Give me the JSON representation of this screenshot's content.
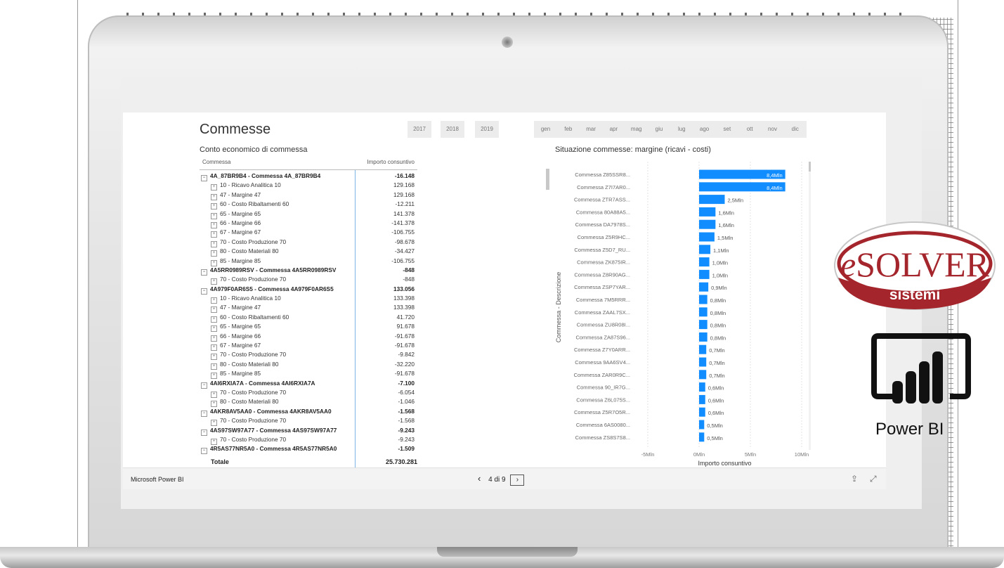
{
  "report": {
    "title": "Commesse",
    "years": [
      "2017",
      "2018",
      "2019"
    ],
    "months": [
      "gen",
      "feb",
      "mar",
      "apr",
      "mag",
      "giu",
      "lug",
      "ago",
      "set",
      "ott",
      "nov",
      "dic"
    ]
  },
  "table": {
    "title": "Conto economico di commessa",
    "col_commessa": "Commessa",
    "col_importo": "Importo consuntivo",
    "rows": [
      {
        "label": "4A_87BR9B4 - Commessa 4A_87BR9B4",
        "value": "-16.148",
        "bold": true
      },
      {
        "label": "10 - Ricavo Analitica 10",
        "value": "129.168"
      },
      {
        "label": "47 - Margine 47",
        "value": "129.168"
      },
      {
        "label": "60 - Costo Ribaltamenti 60",
        "value": "-12.211"
      },
      {
        "label": "65 - Margine 65",
        "value": "141.378"
      },
      {
        "label": "66 - Margine 66",
        "value": "-141.378"
      },
      {
        "label": "67 - Margine 67",
        "value": "-106.755"
      },
      {
        "label": "70 - Costo Produzione 70",
        "value": "-98.678"
      },
      {
        "label": "80 - Costo Materiali 80",
        "value": "-34.427"
      },
      {
        "label": "85 - Margine 85",
        "value": "-106.755"
      },
      {
        "label": "4A5RR0989RSV - Commessa 4A5RR0989RSV",
        "value": "-848",
        "bold": true
      },
      {
        "label": "70 - Costo Produzione 70",
        "value": "-848"
      },
      {
        "label": "4A979F0AR6S5 - Commessa 4A979F0AR6S5",
        "value": "133.056",
        "bold": true
      },
      {
        "label": "10 - Ricavo Analitica 10",
        "value": "133.398"
      },
      {
        "label": "47 - Margine 47",
        "value": "133.398"
      },
      {
        "label": "60 - Costo Ribaltamenti 60",
        "value": "41.720"
      },
      {
        "label": "65 - Margine 65",
        "value": "91.678"
      },
      {
        "label": "66 - Margine 66",
        "value": "-91.678"
      },
      {
        "label": "67 - Margine 67",
        "value": "-91.678"
      },
      {
        "label": "70 - Costo Produzione 70",
        "value": "-9.842"
      },
      {
        "label": "80 - Costo Materiali 80",
        "value": "-32.220"
      },
      {
        "label": "85 - Margine 85",
        "value": "-91.678"
      },
      {
        "label": "4AI6RXIA7A - Commessa 4AI6RXIA7A",
        "value": "-7.100",
        "bold": true
      },
      {
        "label": "70 - Costo Produzione 70",
        "value": "-6.054"
      },
      {
        "label": "80 - Costo Materiali 80",
        "value": "-1.046"
      },
      {
        "label": "4AKR8AV5AA0 - Commessa 4AKR8AV5AA0",
        "value": "-1.568",
        "bold": true
      },
      {
        "label": "70 - Costo Produzione 70",
        "value": "-1.568"
      },
      {
        "label": "4AS97SW97A77 - Commessa 4AS97SW97A77",
        "value": "-9.243",
        "bold": true
      },
      {
        "label": "70 - Costo Produzione 70",
        "value": "-9.243"
      },
      {
        "label": "4R5AS77NR5A0 - Commessa 4R5AS77NR5A0",
        "value": "-1.509",
        "bold": true
      },
      {
        "label": "70 - Costo Produzione 70",
        "value": "-1.509"
      }
    ],
    "total_label": "Totale",
    "total_value": "25.730.281"
  },
  "chart_title": "Situazione commesse: margine (ricavi - costi)",
  "chart_data": {
    "type": "bar",
    "orientation": "horizontal",
    "title": "Situazione commesse: margine (ricavi - costi)",
    "xlabel": "Importo consuntivo",
    "ylabel": "Commessa - Descrizione",
    "xlim": [
      -5,
      10
    ],
    "xticks": [
      "-5Mln",
      "0Mln",
      "5Mln",
      "10Mln"
    ],
    "color": "#118DFF",
    "categories": [
      "Commessa Z85SSR8...",
      "Commessa Z7I7AR0...",
      "Commessa ZTR7ASS...",
      "Commessa 80A88A5...",
      "Commessa DA7978S...",
      "Commessa Z5R9HC...",
      "Commessa Z5D7_RU...",
      "Commessa ZK875IR...",
      "Commessa Z8R90AG...",
      "Commessa ZSP7YAR...",
      "Commessa 7M5RRR...",
      "Commessa ZAAL7SX...",
      "Commessa ZU8R08I...",
      "Commessa ZA87S96...",
      "Commessa Z7Y0ARR...",
      "Commessa 9AA6SV4...",
      "Commessa ZAR0R9C...",
      "Commessa 90_IR7G...",
      "Commessa Z6L075S...",
      "Commessa Z5R7O5R...",
      "Commessa 6AS0080...",
      "Commessa ZS8S7S8..."
    ],
    "values": [
      8.4,
      8.4,
      2.5,
      1.6,
      1.6,
      1.5,
      1.1,
      1.0,
      1.0,
      0.9,
      0.8,
      0.8,
      0.8,
      0.8,
      0.7,
      0.7,
      0.7,
      0.6,
      0.6,
      0.6,
      0.5,
      0.5
    ],
    "labels": [
      "8,4Mln",
      "8,4Mln",
      "2,5Mln",
      "1,6Mln",
      "1,6Mln",
      "1,5Mln",
      "1,1Mln",
      "1,0Mln",
      "1,0Mln",
      "0,9Mln",
      "0,8Mln",
      "0,8Mln",
      "0,8Mln",
      "0,8Mln",
      "0,7Mln",
      "0,7Mln",
      "0,7Mln",
      "0,6Mln",
      "0,6Mln",
      "0,6Mln",
      "0,5Mln",
      "0,5Mln"
    ]
  },
  "footer": {
    "app_name": "Microsoft Power BI",
    "page_indicator": "4 di 9",
    "prev_icon": "chevron-left-icon",
    "next_icon": "chevron-right-icon",
    "share_icon": "share-icon",
    "fullscreen_icon": "expand-icon"
  },
  "logos": {
    "esolver_text": "eSOLVER",
    "esolver_sub": "sistemi",
    "powerbi_text": "Power BI",
    "esolver_color": "#a4262c"
  }
}
